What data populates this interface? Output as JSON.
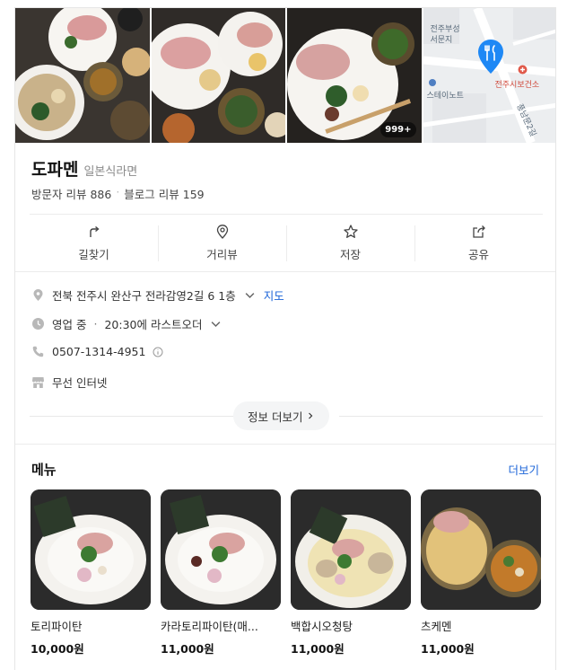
{
  "photos": {
    "more_badge": "999+"
  },
  "map": {
    "labels": {
      "office": "전주부성\n서문지",
      "store": "스테이노트",
      "health": "전주시보건소",
      "road": "풍남문2길"
    }
  },
  "place": {
    "name": "도파멘",
    "category": "일본식라면",
    "visitor_reviews": "방문자 리뷰 886",
    "blog_reviews": "블로그 리뷰 159"
  },
  "actions": [
    {
      "label": "길찾기",
      "icon": "directions-icon"
    },
    {
      "label": "거리뷰",
      "icon": "street-view-icon"
    },
    {
      "label": "저장",
      "icon": "star-icon"
    },
    {
      "label": "공유",
      "icon": "share-icon"
    }
  ],
  "info": {
    "address": "전북 전주시 완산구 전라감영2길 6 1층",
    "map_link": "지도",
    "status": "영업 중",
    "status_detail": "20:30에 라스트오더",
    "phone": "0507-1314-4951",
    "amenity": "무선 인터넷",
    "more_label": "정보 더보기"
  },
  "menu": {
    "title": "메뉴",
    "more_label": "더보기",
    "items": [
      {
        "name": "토리파이탄",
        "price": "10,000원"
      },
      {
        "name": "카라토리파이탄(매...",
        "price": "11,000원"
      },
      {
        "name": "백합시오청탕",
        "price": "11,000원"
      },
      {
        "name": "츠케멘",
        "price": "11,000원"
      }
    ]
  },
  "colors": {
    "accent": "#1a63d8",
    "map_pin": "#1e88f5",
    "badge_bg": "#000000"
  }
}
